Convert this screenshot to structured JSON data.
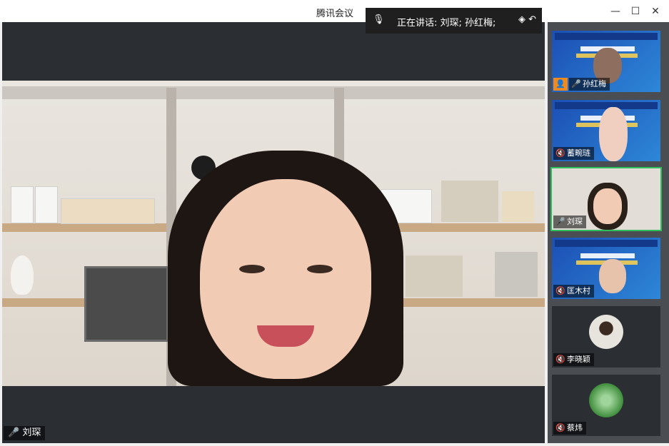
{
  "window": {
    "title": "腾讯会议",
    "minimize": "—",
    "maximize": "☐",
    "close": "✕"
  },
  "speaking": {
    "mic_icon": "🎙",
    "text": "正在讲话: 刘琛; 孙红梅;",
    "controls": "◈ ↶"
  },
  "main_video": {
    "participant": "刘琛",
    "mic_icon": "🎤"
  },
  "participants": [
    {
      "name": "孙红梅",
      "mic": "🎤",
      "host_icon": "👤"
    },
    {
      "name": "蓄畹琏",
      "mic": "🔇"
    },
    {
      "name": "刘琛",
      "mic": "🎤"
    },
    {
      "name": "匡木村",
      "mic": "🔇"
    },
    {
      "name": "李晓颖",
      "mic": "🔇"
    },
    {
      "name": "蔡炜",
      "mic": "🔇"
    }
  ]
}
